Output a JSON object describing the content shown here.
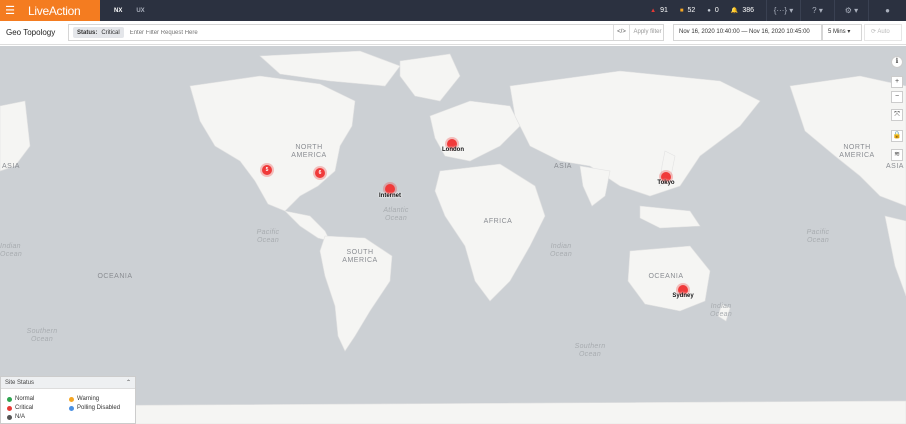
{
  "app": {
    "brand": "LiveAction",
    "tabs": [
      "NX",
      "UX"
    ]
  },
  "header_alerts": [
    {
      "icon": "triangle-icon",
      "count": "91",
      "color": "#e53935"
    },
    {
      "icon": "square-icon",
      "count": "52",
      "color": "#f5a623"
    },
    {
      "icon": "dot-icon",
      "count": "0",
      "color": "#9aa3b2"
    },
    {
      "icon": "bell-icon",
      "count": "386",
      "color": "#4a90e2"
    }
  ],
  "header_icons": {
    "brackets": "{···}",
    "help": "?",
    "settings": "⚙",
    "user": "👤"
  },
  "page": {
    "title": "Geo Topology"
  },
  "filter": {
    "chip_key": "Status:",
    "chip_value": "Critical",
    "placeholder": "Enter Filter Request Here",
    "code_label": "</>",
    "apply_label": "Apply filter"
  },
  "time": {
    "range": "Nov 16, 2020 10:40:00 — Nov 16, 2020 10:45:00",
    "interval": "5 Mins",
    "auto_label": "Auto"
  },
  "map": {
    "continents": [
      {
        "name": "NORTH AMERICA"
      },
      {
        "name": "SOUTH AMERICA"
      },
      {
        "name": "AFRICA"
      },
      {
        "name": "ASIA"
      },
      {
        "name": "ASIA"
      },
      {
        "name": "OCEANIA"
      },
      {
        "name": "OCEANIA"
      },
      {
        "name": "NORTH AMERICA"
      },
      {
        "name": "ASIA"
      }
    ],
    "oceans": [
      {
        "name": "Atlantic Ocean"
      },
      {
        "name": "Pacific Ocean"
      },
      {
        "name": "Indian Ocean"
      },
      {
        "name": "Southern Ocean"
      },
      {
        "name": "Southern Ocean"
      },
      {
        "name": "Pacific Ocean"
      },
      {
        "name": "Indian Ocean"
      },
      {
        "name": "Indian Ocean"
      }
    ],
    "sites": [
      {
        "name": "London"
      },
      {
        "name": "Internet"
      },
      {
        "name": "Tokyo"
      },
      {
        "name": "Sydney"
      }
    ],
    "clusters": [
      {
        "count": "5"
      },
      {
        "count": "6"
      }
    ],
    "controls": [
      "info-icon",
      "zoom-in-icon",
      "zoom-out-icon",
      "fullscreen-icon",
      "lock-icon",
      "layers-icon"
    ]
  },
  "legend": {
    "title": "Site Status",
    "items": [
      {
        "label": "Normal",
        "color": "#2ea44f"
      },
      {
        "label": "Warning",
        "color": "#f5a623"
      },
      {
        "label": "Critical",
        "color": "#e53935"
      },
      {
        "label": "Polling Disabled",
        "color": "#4a90e2"
      },
      {
        "label": "N/A",
        "color": "#555555"
      }
    ]
  }
}
